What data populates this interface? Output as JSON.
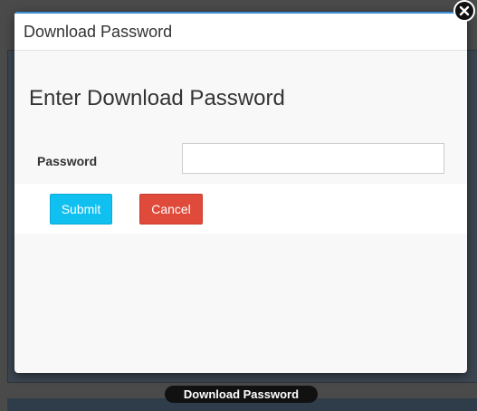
{
  "modal": {
    "header_title": "Download Password",
    "body_title": "Enter Download Password",
    "password_label": "Password",
    "password_value": "",
    "password_placeholder": "",
    "submit_label": "Submit",
    "cancel_label": "Cancel"
  },
  "background": {
    "pill_label": "Download Password"
  },
  "icons": {
    "close": "close-icon"
  },
  "colors": {
    "header_accent": "#3a8fd6",
    "submit": "#0fc0f0",
    "cancel": "#e04a3a"
  }
}
